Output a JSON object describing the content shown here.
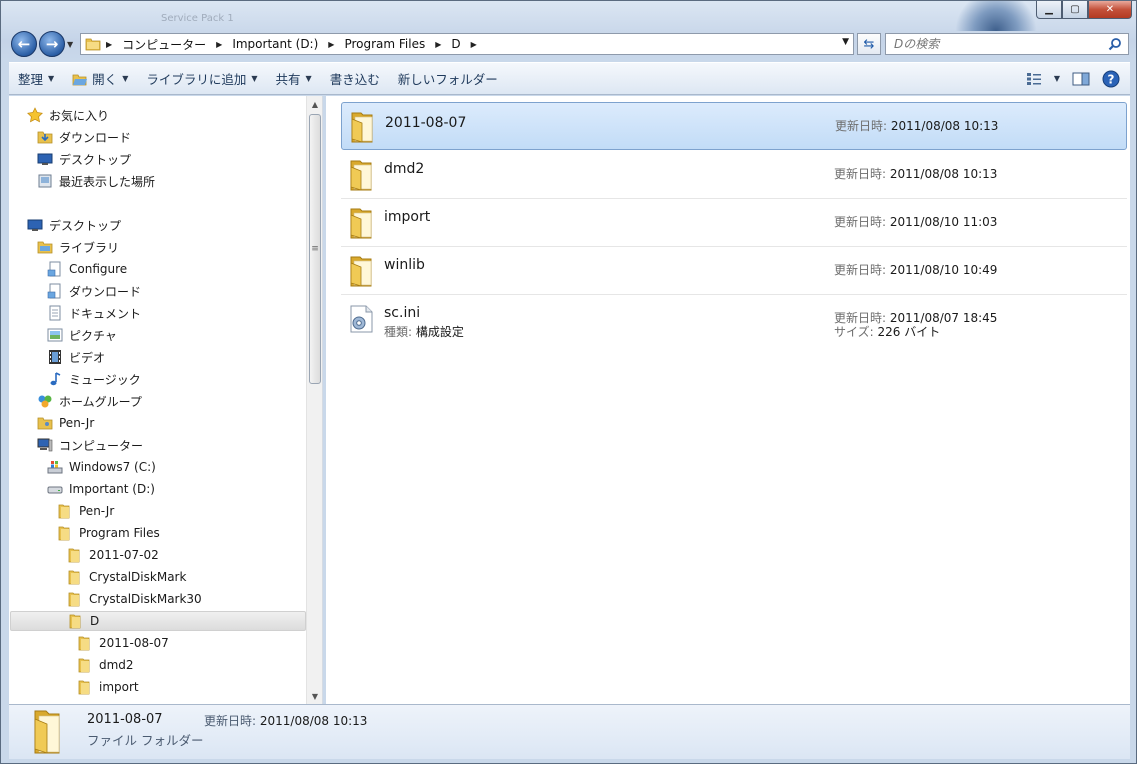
{
  "window": {
    "ghost_title": "Service Pack 1"
  },
  "address": {
    "crumbs": [
      "コンピューター",
      "Important (D:)",
      "Program Files",
      "D"
    ]
  },
  "search": {
    "placeholder": "Dの検索"
  },
  "toolbar": {
    "organize": "整理",
    "open": "開く",
    "add_library": "ライブラリに追加",
    "share": "共有",
    "burn": "書き込む",
    "new_folder": "新しいフォルダー"
  },
  "nav": {
    "favorites": "お気に入り",
    "downloads": "ダウンロード",
    "desktop_fav": "デスクトップ",
    "recent": "最近表示した場所",
    "desktop": "デスクトップ",
    "libraries": "ライブラリ",
    "configure": "Configure",
    "lib_downloads": "ダウンロード",
    "documents": "ドキュメント",
    "pictures": "ピクチャ",
    "videos": "ビデオ",
    "music": "ミュージック",
    "homegroup": "ホームグループ",
    "pen_jr": "Pen-Jr",
    "computer": "コンピューター",
    "drive_c": "Windows7 (C:)",
    "drive_d": "Important (D:)",
    "d_penjr": "Pen-Jr",
    "program_files": "Program Files",
    "pf_2011": "2011-07-02",
    "pf_cdm": "CrystalDiskMark",
    "pf_cdm30": "CrystalDiskMark30",
    "pf_d": "D",
    "d_2011": "2011-08-07",
    "d_dmd2": "dmd2",
    "d_import": "import"
  },
  "items": [
    {
      "name": "2011-08-07",
      "date_label": "更新日時:",
      "date": "2011/08/08 10:13"
    },
    {
      "name": "dmd2",
      "date_label": "更新日時:",
      "date": "2011/08/08 10:13"
    },
    {
      "name": "import",
      "date_label": "更新日時:",
      "date": "2011/08/10 11:03"
    },
    {
      "name": "winlib",
      "date_label": "更新日時:",
      "date": "2011/08/10 10:49"
    },
    {
      "name": "sc.ini",
      "date_label": "更新日時:",
      "date": "2011/08/07 18:45",
      "type_label": "種類:",
      "type": "構成設定",
      "size_label": "サイズ:",
      "size": "226 バイト"
    }
  ],
  "details": {
    "name": "2011-08-07",
    "date_label": "更新日時:",
    "date": "2011/08/08 10:13",
    "type": "ファイル フォルダー"
  },
  "icons": {
    "folder": "folder-icon",
    "ini": "config-file-icon",
    "star": "star-icon",
    "computer": "computer-icon"
  },
  "colors": {
    "selection": "#c2dcf7",
    "selection_border": "#7da2ce",
    "toolbar_text": "#1e395b",
    "folder": "#e8c14e"
  }
}
